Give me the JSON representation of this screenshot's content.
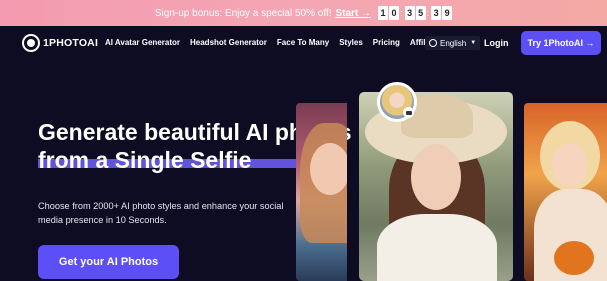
{
  "promo": {
    "text": "Sign-up bonus: Enjoy a special 50% off!",
    "link": "Start →",
    "countdown": [
      "1",
      "0",
      "3",
      "5",
      "3",
      "9"
    ]
  },
  "header": {
    "logo_text": "1PHOTOAI",
    "links": [
      "AI Avatar Generator",
      "Headshot Generator",
      "Face To Many",
      "Styles",
      "Pricing",
      "Affiliates"
    ],
    "language": "English",
    "login": "Login",
    "try_button": "Try 1PhotoAI →"
  },
  "hero": {
    "title_line1": "Generate beautiful AI photos",
    "title_line2": "from a Single Selfie",
    "subtitle": "Choose from 2000+ AI photo styles and enhance your social media presence in 10 Seconds.",
    "cta": "Get your AI Photos"
  },
  "colors": {
    "accent": "#5b4ff5",
    "background": "#0d0c22",
    "promo_bar": "#f4a6b4"
  }
}
